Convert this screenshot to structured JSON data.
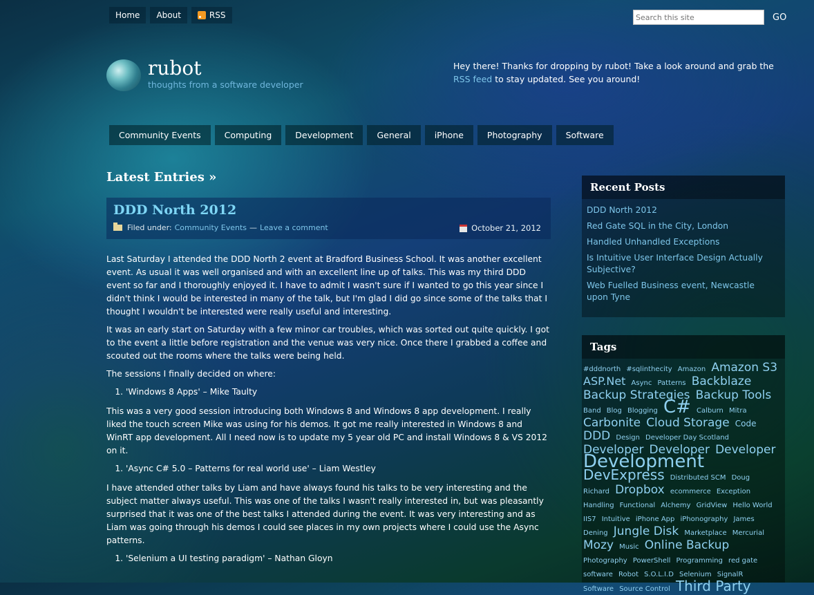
{
  "topnav": {
    "items": [
      {
        "label": "Home"
      },
      {
        "label": "About"
      },
      {
        "label": "RSS",
        "icon": "rss-icon"
      }
    ]
  },
  "search": {
    "placeholder": "Search this site",
    "button": "GO"
  },
  "site": {
    "title": "rubot",
    "tagline": "thoughts from a software developer"
  },
  "welcome": {
    "before": "Hey there! Thanks for dropping by rubot! Take a look around and grab the ",
    "link": "RSS feed",
    "after": " to stay updated. See you around!"
  },
  "categories": [
    "Community Events",
    "Computing",
    "Development",
    "General",
    "iPhone",
    "Photography",
    "Software"
  ],
  "main": {
    "heading": "Latest Entries »"
  },
  "post": {
    "title": "DDD North 2012",
    "filed_under": "Filed under:",
    "category": "Community Events",
    "separator": "—",
    "comment_link": "Leave a comment",
    "date": "October 21, 2012",
    "p1": "Last Saturday I attended the DDD North 2 event at Bradford Business School. It was another excellent event. As usual it was well organised and with an excellent line up of talks. This was my third DDD event so far and I thoroughly enjoyed it. I have to admit I wasn't sure if I wanted to go this year since I didn't think I would be interested in many of the talk, but I'm glad I did go since some of the talks that I thought I wouldn't be interested were really useful and interesting.",
    "p2": "It was an early start on Saturday with a few minor car troubles, which was sorted out quite quickly. I got to the event a little before registration and the venue was very nice. Once there I grabbed a coffee and scouted out the rooms where the talks were being held.",
    "p3": "The sessions I finally decided on where:",
    "li1": "'Windows 8 Apps' – Mike Taulty",
    "p4": "This was a very good session introducing both Windows 8 and Windows 8 app development. I really liked the touch screen Mike was using for his demos. It got me really interested in Windows 8 and WinRT app development. All I need now is to update my 5 year old PC and install Windows 8 & VS 2012 on it.",
    "li2": "'Async C# 5.0 – Patterns for real world use' – Liam Westley",
    "p5": "I have attended other talks by Liam and have always found his talks to be very interesting and the subject matter always useful. This was one of the talks I wasn't really interested in, but was pleasantly surprised that it was one of the best talks I attended during the event. It was very interesting and as Liam was going through his demos I could see places in my own projects where I could use the Async patterns.",
    "li3": "'Selenium a UI testing paradigm' – Nathan Gloyn"
  },
  "sidebar": {
    "recent_title": "Recent Posts",
    "recent_posts": [
      "DDD North 2012",
      "Red Gate SQL in the City, London",
      "Handled Unhandled Exceptions",
      "Is Intuitive User Interface Design Actually Subjective?",
      "Web Fuelled Business event, Newcastle upon Tyne"
    ],
    "tags_title": "Tags",
    "tags": [
      {
        "t": "#dddnorth",
        "s": 10
      },
      {
        "t": "#sqlinthecity",
        "s": 10
      },
      {
        "t": "Amazon",
        "s": 10
      },
      {
        "t": "Amazon S3",
        "s": 17
      },
      {
        "t": "ASP.Net",
        "s": 16
      },
      {
        "t": "Async",
        "s": 10
      },
      {
        "t": "Patterns",
        "s": 10
      },
      {
        "t": "Backblaze",
        "s": 17
      },
      {
        "t": "Backup Strategies",
        "s": 17
      },
      {
        "t": "Backup Tools",
        "s": 17
      },
      {
        "t": "Band",
        "s": 10
      },
      {
        "t": "Blog",
        "s": 10
      },
      {
        "t": "Blogging",
        "s": 10
      },
      {
        "t": "C#",
        "s": 26
      },
      {
        "t": "Calburn",
        "s": 10
      },
      {
        "t": "Mitra",
        "s": 10
      },
      {
        "t": "Carbonite",
        "s": 17
      },
      {
        "t": "Cloud Storage",
        "s": 17
      },
      {
        "t": "Code",
        "s": 12
      },
      {
        "t": "DDD",
        "s": 17
      },
      {
        "t": "Design",
        "s": 10
      },
      {
        "t": "Developer Day Scotland",
        "s": 10
      },
      {
        "t": "Developer",
        "s": 17
      },
      {
        "t": "Developer",
        "s": 17
      },
      {
        "t": "Developer",
        "s": 17
      },
      {
        "t": "Development",
        "s": 26
      },
      {
        "t": "DevExpress",
        "s": 20
      },
      {
        "t": "Distributed SCM",
        "s": 10
      },
      {
        "t": "Doug",
        "s": 10
      },
      {
        "t": "Richard",
        "s": 10
      },
      {
        "t": "Dropbox",
        "s": 17
      },
      {
        "t": "ecommerce",
        "s": 10
      },
      {
        "t": "Exception",
        "s": 10
      },
      {
        "t": "Handling",
        "s": 10
      },
      {
        "t": "Functional",
        "s": 10
      },
      {
        "t": "Alchemy",
        "s": 10
      },
      {
        "t": "GridView",
        "s": 10
      },
      {
        "t": "Hello World",
        "s": 10
      },
      {
        "t": "IIS7",
        "s": 10
      },
      {
        "t": "Intuitive",
        "s": 10
      },
      {
        "t": "iPhone App",
        "s": 10
      },
      {
        "t": "iPhonography",
        "s": 10
      },
      {
        "t": "James",
        "s": 10
      },
      {
        "t": "Dening",
        "s": 10
      },
      {
        "t": "Jungle Disk",
        "s": 17
      },
      {
        "t": "Marketplace",
        "s": 10
      },
      {
        "t": "Mercurial",
        "s": 10
      },
      {
        "t": "Mozy",
        "s": 17
      },
      {
        "t": "Music",
        "s": 10
      },
      {
        "t": "Online Backup",
        "s": 17
      },
      {
        "t": "Photography",
        "s": 10
      },
      {
        "t": "PowerShell",
        "s": 10
      },
      {
        "t": "Programming",
        "s": 10
      },
      {
        "t": "red gate software",
        "s": 10
      },
      {
        "t": "Robot",
        "s": 10
      },
      {
        "t": "S.O.L.I.D",
        "s": 10
      },
      {
        "t": "Selenium",
        "s": 10
      },
      {
        "t": "SignalR",
        "s": 10
      },
      {
        "t": "Software",
        "s": 10
      },
      {
        "t": "Source Control",
        "s": 10
      },
      {
        "t": "Third Party",
        "s": 20
      }
    ]
  }
}
